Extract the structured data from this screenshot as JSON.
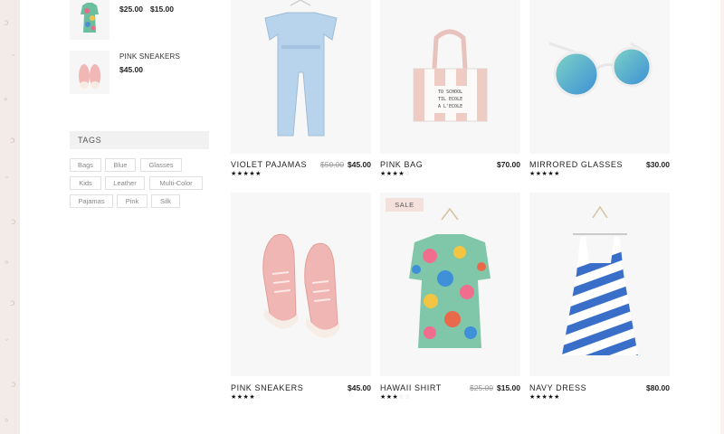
{
  "sidebar": {
    "recent_products": [
      {
        "name": "",
        "old_price": "$25.00",
        "price": "$15.00"
      },
      {
        "name": "PINK SNEAKERS",
        "price": "$45.00"
      }
    ],
    "tags_title": "TAGS",
    "tags": [
      "Bags",
      "Blue",
      "Glasses",
      "Kids",
      "Leather",
      "Multi-Color",
      "Pajamas",
      "Pink",
      "Silk"
    ]
  },
  "products": [
    {
      "name": "VIOLET PAJAMAS",
      "old_price": "$50.00",
      "price": "$45.00",
      "rating": 5,
      "icon": "jumpsuit-image"
    },
    {
      "name": "PINK BAG",
      "price": "$70.00",
      "rating": 4,
      "icon": "tote-bag-image",
      "bag_text": [
        "TO SCHOOL",
        "TIL ECOLE",
        "A L'ECOLE"
      ]
    },
    {
      "name": "MIRRORED GLASSES",
      "price": "$30.00",
      "rating": 5,
      "icon": "sunglasses-image"
    },
    {
      "name": "PINK SNEAKERS",
      "price": "$45.00",
      "rating": 4,
      "icon": "sneakers-image"
    },
    {
      "name": "HAWAII SHIRT",
      "old_price": "$25.00",
      "price": "$15.00",
      "rating": 3,
      "badge": "SALE",
      "icon": "floral-dress-image"
    },
    {
      "name": "NAVY DRESS",
      "price": "$80.00",
      "rating": 5,
      "icon": "striped-dress-image"
    }
  ],
  "colors": {
    "badge_bg": "#f5e1dc",
    "tag_border": "#e1e1e1",
    "deco_bg": "#f3ebe8"
  }
}
